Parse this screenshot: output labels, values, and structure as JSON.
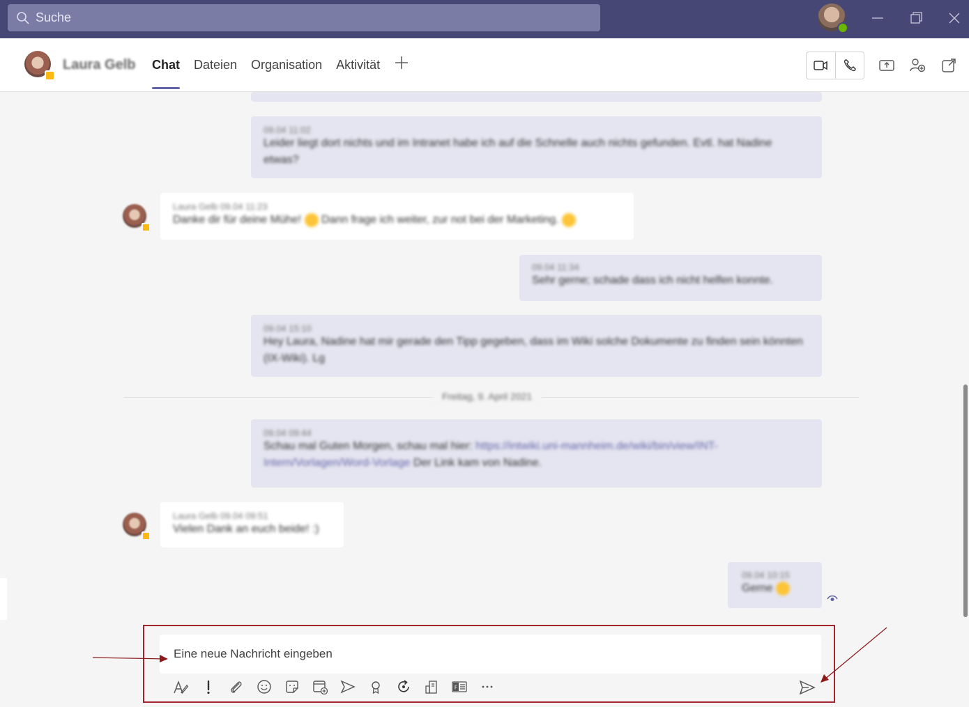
{
  "search": {
    "placeholder": "Suche"
  },
  "contact": {
    "name": "Laura Gelb"
  },
  "tabs": [
    {
      "label": "Chat",
      "active": true
    },
    {
      "label": "Dateien"
    },
    {
      "label": "Organisation"
    },
    {
      "label": "Aktivität"
    }
  ],
  "messages": [
    {
      "meta": "09.04 11:02",
      "text": "Leider liegt dort nichts und im Intranet habe ich auf die Schnelle auch nichts gefunden. Evtl. hat Nadine etwas?"
    },
    {
      "meta": "Laura Gelb  09.04 11:23",
      "text_a": "Danke dir für deine Mühe!",
      "text_b": "Dann frage ich weiter, zur not bei der Marketing."
    },
    {
      "meta": "09.04 11:34",
      "text": "Sehr gerne; schade dass ich nicht helfen konnte."
    },
    {
      "meta": "09.04 15:10",
      "text": "Hey Laura, Nadine hat mir gerade den Tipp gegeben, dass im Wiki solche Dokumente zu finden sein könnten (IX-Wiki). Lg"
    },
    {
      "meta": "09.04 09:44",
      "text_a": "Schau mal Guten Morgen, schau mal hier:",
      "link": "https://intwiki.uni-mannheim.de/wiki/bin/view/INT-Intern/Vorlagen/Word-Vorlage",
      "text_b": "Der Link kam von Nadine."
    },
    {
      "meta": "Laura Gelb  09.04 09:51",
      "text": "Vielen Dank an euch beide! :)"
    },
    {
      "meta": "09.04 10:15",
      "text": "Gerne"
    }
  ],
  "date_separator": "Freitag, 9. April 2021",
  "compose": {
    "placeholder": "Eine neue Nachricht eingeben"
  },
  "colors": {
    "titlebar": "#464775",
    "accent": "#6264a7",
    "highlight": "#a4262c",
    "mine_bubble": "#e5e5f1"
  }
}
